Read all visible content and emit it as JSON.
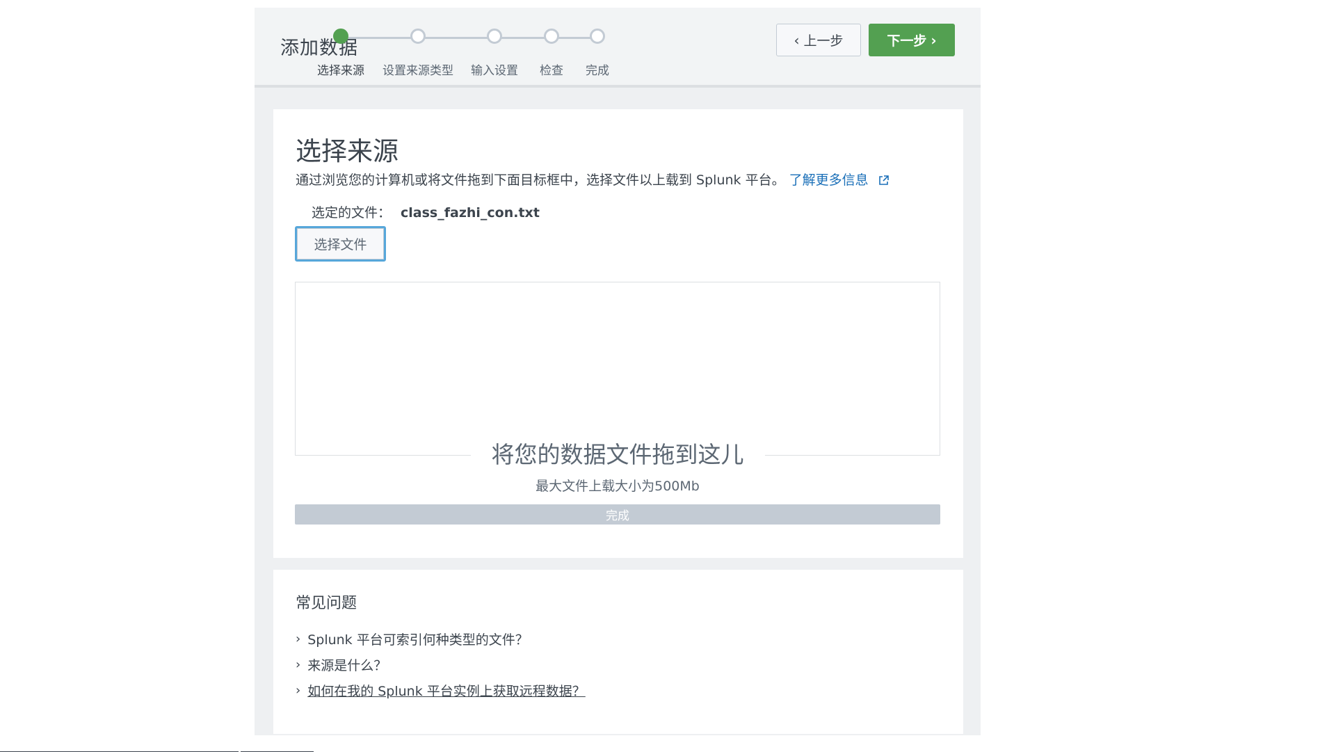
{
  "header": {
    "title": "添加数据",
    "steps": [
      {
        "label": "选择来源",
        "active": true
      },
      {
        "label": "设置来源类型",
        "active": false
      },
      {
        "label": "输入设置",
        "active": false
      },
      {
        "label": "检查",
        "active": false
      },
      {
        "label": "完成",
        "active": false
      }
    ],
    "back_label": "上一步",
    "next_label": "下一步",
    "accent_color": "#53a051"
  },
  "source": {
    "title": "选择来源",
    "description": "通过浏览您的计算机或将文件拖到下面目标框中，选择文件以上载到 Splunk 平台。",
    "learn_more": "了解更多信息",
    "selected_label": "选定的文件：",
    "selected_file": "class_fazhi_con.txt",
    "choose_button": "选择文件",
    "drop_title": "将您的数据文件拖到这儿",
    "drop_subtitle": "最大文件上载大小为500Mb",
    "progress_label": "完成"
  },
  "faq": {
    "title": "常见问题",
    "items": [
      "Splunk 平台可索引何种类型的文件？",
      "来源是什么？",
      "如何在我的 Splunk 平台实例上获取远程数据？"
    ]
  }
}
